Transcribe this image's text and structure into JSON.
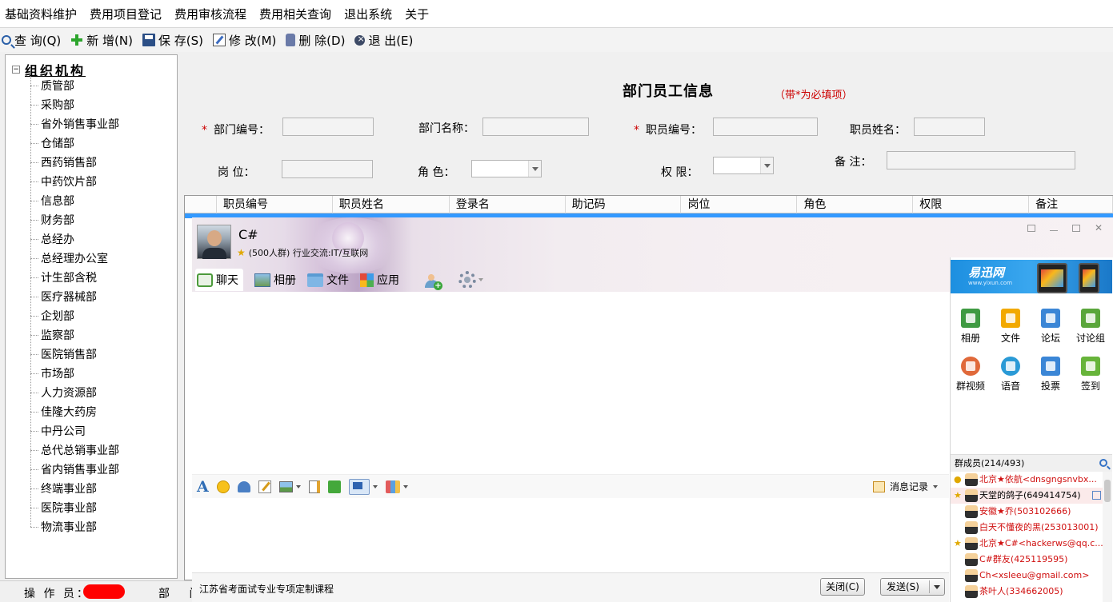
{
  "menu": [
    "基础资料维护",
    "费用项目登记",
    "费用审核流程",
    "费用相关查询",
    "退出系统",
    "关于"
  ],
  "toolbar": {
    "query": "查 询(Q)",
    "add": "新 增(N)",
    "save": "保 存(S)",
    "edit": "修 改(M)",
    "delete": "删 除(D)",
    "exit": "退  出(E)"
  },
  "tree": {
    "root": "组织机构",
    "items": [
      "质管部",
      "采购部",
      "省外销售事业部",
      "仓储部",
      "西药销售部",
      "中药饮片部",
      "信息部",
      "财务部",
      "总经办",
      "总经理办公室",
      "计生部含税",
      "医疗器械部",
      "企划部",
      "监察部",
      "医院销售部",
      "市场部",
      "人力资源部",
      "佳隆大药房",
      "中丹公司",
      "总代总销事业部",
      "省内销售事业部",
      "终端事业部",
      "医院事业部",
      "物流事业部"
    ]
  },
  "form": {
    "title": "部门员工信息",
    "required_note": "（带*为必填项）",
    "required_mark": "*",
    "dept_code_label": "部门编号：",
    "dept_name_label": "部门名称：",
    "emp_code_label": "职员编号：",
    "emp_name_label": "职员姓名：",
    "position_label": "岗   位：",
    "role_label": "角   色：",
    "permission_label": "权  限：",
    "remark_label": "备   注："
  },
  "grid": {
    "columns": [
      "职员编号",
      "职员姓名",
      "登录名",
      "助记码",
      "岗位",
      "角色",
      "权限",
      "备注"
    ]
  },
  "status": {
    "operator_label": "操 作 员：",
    "dept_label": "部 门"
  },
  "chat": {
    "name": "C#",
    "description": "(500人群) 行业交流:IT/互联网",
    "tabs": [
      "聊天",
      "相册",
      "文件",
      "应用"
    ],
    "message_log": "消息记录",
    "footer_text": "江苏省考面试专业专项定制课程",
    "close_button": "关闭(C)",
    "send_button": "发送(S)",
    "ad_logo": "易迅网",
    "ad_url": "www.yixun.com",
    "apps": [
      "相册",
      "文件",
      "论坛",
      "讨论组",
      "群视频",
      "语音",
      "投票",
      "签到"
    ],
    "members_header": "群成员(214/493)",
    "members": [
      {
        "name": "北京★依航<dnsgngsnvbx...",
        "style": "red"
      },
      {
        "name": "天堂的鸽子(649414754)",
        "style": "blue"
      },
      {
        "name": "安徽★乔(503102666)",
        "style": "red"
      },
      {
        "name": "白天不懂夜的黑(253013001)",
        "style": "red"
      },
      {
        "name": "北京★C#<hackerws@qq.c...",
        "style": "red"
      },
      {
        "name": "C#群友(425119595)",
        "style": "red"
      },
      {
        "name": "Ch<xsleeu@gmail.com>",
        "style": "red"
      },
      {
        "name": "茶叶人(334662005)",
        "style": "red"
      }
    ]
  }
}
